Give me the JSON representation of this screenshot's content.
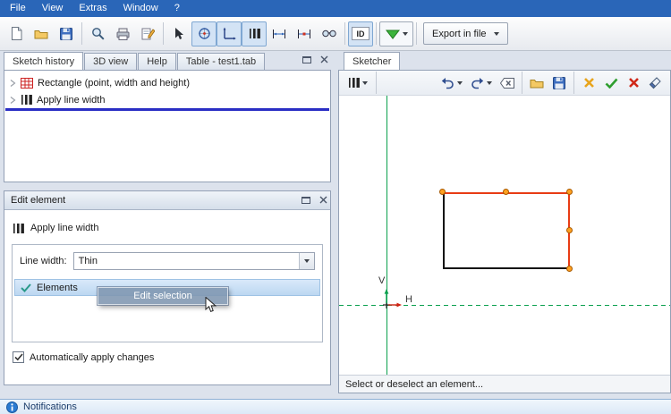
{
  "menu": {
    "items": [
      "File",
      "View",
      "Extras",
      "Window",
      "?"
    ]
  },
  "main_toolbar": {
    "id_label": "ID",
    "export_label": "Export in file"
  },
  "left_panel": {
    "tabs": [
      "Sketch history",
      "3D view",
      "Help",
      "Table - test1.tab"
    ],
    "items": [
      {
        "label": "Rectangle (point, width and height)"
      },
      {
        "label": "Apply line width"
      }
    ]
  },
  "edit_panel": {
    "title": "Edit element",
    "header": "Apply line width",
    "line_width_label": "Line width:",
    "line_width_value": "Thin",
    "elements_label": "Elements",
    "tooltip": "Edit selection",
    "checkbox_label": "Automatically apply changes"
  },
  "sketcher": {
    "tab": "Sketcher",
    "status": "Select or deselect an element...",
    "axis_v": "V",
    "axis_h": "H"
  },
  "notifications": {
    "label": "Notifications"
  },
  "colors": {
    "menu_bar": "#2a66b8",
    "insertion_line": "#2a2ec4",
    "axis_green": "#0aa04e",
    "edge_red": "#e83c14",
    "handle_orange": "#ffa020",
    "selection_fill": "#bcd7f1"
  }
}
